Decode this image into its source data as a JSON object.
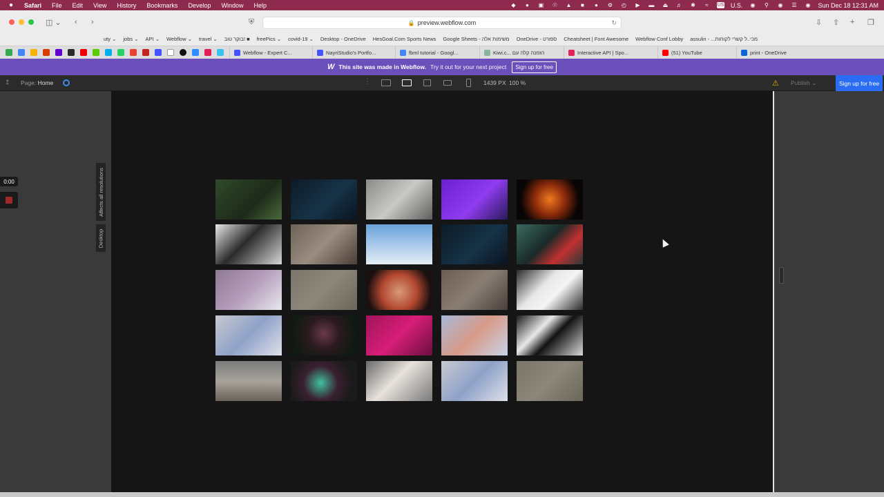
{
  "menubar": {
    "app": "Safari",
    "items": [
      "File",
      "Edit",
      "View",
      "History",
      "Bookmarks",
      "Develop",
      "Window",
      "Help"
    ],
    "input_source": "U.S.",
    "clock": "Sun Dec 18  12:31 AM"
  },
  "toolbar": {
    "url": "preview.webflow.com"
  },
  "favorites": [
    "uty ⌄",
    "jobs ⌄",
    "API ⌄",
    "Webflow ⌄",
    "travel ⌄",
    "בוקר טוב! ■",
    "freePics ⌄",
    "covid-19 ⌄",
    "Desktop - OneDrive",
    "HesGoal.Com Sports News",
    "Google Sheets - משימות אלה",
    "OneDrive - ספורט",
    "Cheatsheet | Font Awesome",
    "Webflow Conf Lobby",
    "assulin - ...מכי..ל קשרי לקוחות"
  ],
  "tabs": [
    {
      "label": "Webflow - Expert C...",
      "color": "#4353ff"
    },
    {
      "label": "NayriStudio's Portfo...",
      "color": "#4353ff"
    },
    {
      "label": "fbml tutorial - Googl...",
      "color": "#4285f4"
    },
    {
      "label": "Kiwi.c... הזמנה קלה עם",
      "color": "#8ab4a0"
    },
    {
      "label": "Interactive API | Spo...",
      "color": "#e0245e"
    },
    {
      "label": "(51) YouTube",
      "color": "#ff0000"
    },
    {
      "label": "print - OneDrive",
      "color": "#0a64d6"
    }
  ],
  "banner": {
    "logo": "W",
    "message": "This site was made in Webflow.",
    "cta": "Try it out for your next project",
    "button": "Sign up for free"
  },
  "designer": {
    "page_label": "Page:",
    "page_name": "Home",
    "width": "1439",
    "width_unit": "PX",
    "zoom": "100",
    "zoom_unit": "%",
    "publish": "Publish ⌄",
    "signup": "Sign up for free"
  },
  "left_panel": {
    "timer": "0:00",
    "vertical_label_1": "Affects all resolutions",
    "vertical_label_2": "Desktop"
  },
  "gallery": {
    "tiles": [
      {
        "bg": "linear-gradient(135deg,#2f4a2a,#1d2a1a 60%,#4a6a3a)"
      },
      {
        "bg": "linear-gradient(135deg,#0d1a26,#163348 55%,#0b1420)"
      },
      {
        "bg": "linear-gradient(135deg,#8a8a88,#c9c9c6 50%,#5e5e5c)"
      },
      {
        "bg": "linear-gradient(135deg,#6b1fd0,#8f3cf0 55%,#2a1a5a)"
      },
      {
        "bg": "radial-gradient(circle at 50% 50%,#f07a20,#8a2a0a 40%,#0a0505 75%)"
      },
      {
        "bg": "linear-gradient(135deg,#e8e8e8,#2a2a2a 45%,#d6d6d6)"
      },
      {
        "bg": "linear-gradient(135deg,#6e6258,#9a8c80 50%,#4a3e36)"
      },
      {
        "bg": "linear-gradient(180deg,#6aa2d8,#a8c8ea 50%,#e4eef6)"
      },
      {
        "bg": "linear-gradient(135deg,#0d1a26,#163348 55%,#0b1420)"
      },
      {
        "bg": "linear-gradient(135deg,#3a6a60,#1a2a28 45%,#c23030 70%,#2a3a38)"
      },
      {
        "bg": "linear-gradient(135deg,#8f7a94,#b49cba 50%,#e8e8ee)"
      },
      {
        "bg": "linear-gradient(135deg,#7a7568,#8c877a 50%,#6a665a)"
      },
      {
        "bg": "radial-gradient(circle at 50% 55%,#d89a7a,#b2472f 45%,#1a1010 80%)"
      },
      {
        "bg": "linear-gradient(135deg,#6a5e54,#8a7e74 50%,#4a403a)"
      },
      {
        "bg": "linear-gradient(135deg,#2a2a2a,#e8e8e8 40%,#f4f4f4 60%,#2a2a2a)"
      },
      {
        "bg": "linear-gradient(135deg,#c8c8d0,#8ea2c8 50%,#e0e0e8)"
      },
      {
        "bg": "radial-gradient(circle at 50% 45%,#6a3a4a,#2a1a1e 40%,#101a12 80%)"
      },
      {
        "bg": "linear-gradient(135deg,#a0135a,#d81e78 50%,#6a0e3e)"
      },
      {
        "bg": "linear-gradient(135deg,#a8b8d8,#d89a88 50%,#c8d4ea)"
      },
      {
        "bg": "linear-gradient(135deg,#1a1a1a,#e8e8e8 35%,#111 55%,#d8d8d8)"
      },
      {
        "bg": "linear-gradient(180deg,#7a7a7a,#a8a49c 50%,#6a6258)"
      },
      {
        "bg": "radial-gradient(circle at 45% 55%,#40c0a0,#3a2030 40%,#1a1a1a 75%)"
      },
      {
        "bg": "linear-gradient(135deg,#6a6a6a,#e8e2dc 45%,#7a7a7a)"
      },
      {
        "bg": "linear-gradient(135deg,#c8c8d0,#8ea2c8 50%,#e0e0e8)"
      },
      {
        "bg": "linear-gradient(135deg,#7a7568,#8c877a 50%,#6a665a)"
      }
    ]
  }
}
